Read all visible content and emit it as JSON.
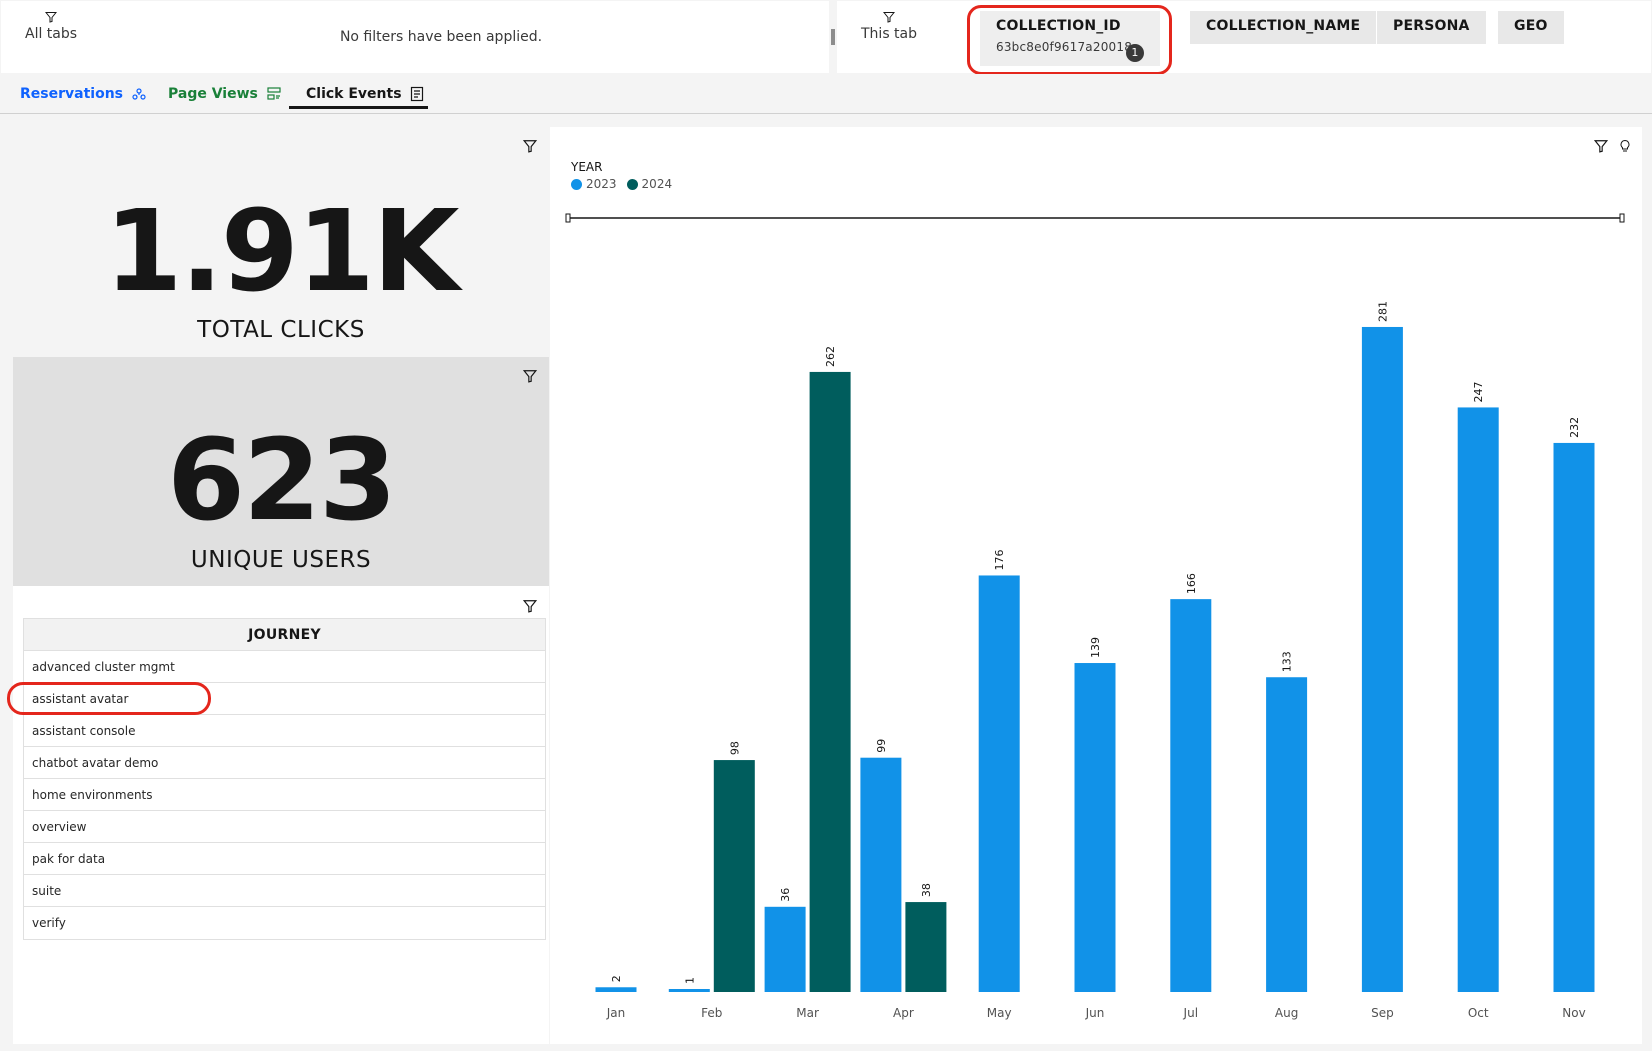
{
  "filters": {
    "all_tabs_label": "All tabs",
    "no_filters_text": "No filters have been applied.",
    "this_tab_label": "This tab",
    "chips": [
      {
        "label": "COLLECTION_ID",
        "value": "63bc8e0f9617a20018c0",
        "count": "1"
      },
      {
        "label": "COLLECTION_NAME"
      },
      {
        "label": "PERSONA"
      },
      {
        "label": "GEO"
      }
    ]
  },
  "tabs": [
    {
      "label": "Reservations",
      "color": "#0f62fe",
      "icon": "reservations-icon"
    },
    {
      "label": "Page Views",
      "color": "#198038",
      "icon": "page-views-icon"
    },
    {
      "label": "Click Events",
      "color": "#161616",
      "icon": "click-events-icon",
      "selected": true
    }
  ],
  "kpis": {
    "total_clicks": {
      "value": "1.91K",
      "label": "TOTAL CLICKS"
    },
    "unique_users": {
      "value": "623",
      "label": "UNIQUE USERS"
    }
  },
  "journey": {
    "header": "JOURNEY",
    "rows": [
      "advanced cluster mgmt",
      "assistant avatar",
      "assistant console",
      "chatbot avatar demo",
      "home environments",
      "overview",
      "pak for data",
      "suite",
      "verify"
    ]
  },
  "chart_data": {
    "type": "bar",
    "legend_title": "YEAR",
    "categories": [
      "Jan",
      "Feb",
      "Mar",
      "Apr",
      "May",
      "Jun",
      "Jul",
      "Aug",
      "Sep",
      "Oct",
      "Nov"
    ],
    "series": [
      {
        "name": "2023",
        "color": "#1192e8",
        "values": [
          2,
          1,
          36,
          99,
          176,
          139,
          166,
          133,
          281,
          247,
          232
        ]
      },
      {
        "name": "2024",
        "color": "#005d5d",
        "values": [
          null,
          98,
          262,
          38,
          null,
          null,
          null,
          null,
          null,
          null,
          null
        ]
      }
    ],
    "ylim": [
      0,
      300
    ],
    "grid": false,
    "legend_position": "top-left",
    "data_labels": true
  }
}
